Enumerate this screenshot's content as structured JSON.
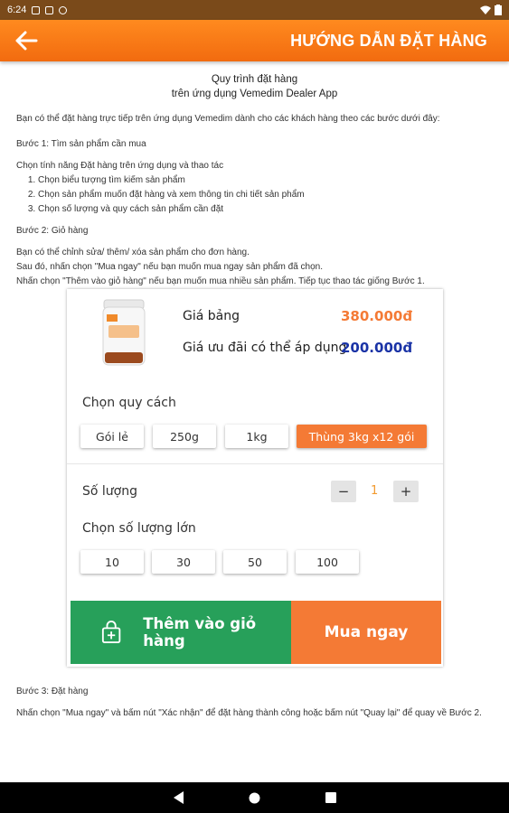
{
  "status_bar": {
    "time": "6:24"
  },
  "app_bar": {
    "title": "HƯỚNG DẪN ĐẶT HÀNG"
  },
  "guide": {
    "title_line1": "Quy trình đặt hàng",
    "title_line2": "trên ứng dụng Vemedim Dealer App",
    "intro": "Bạn có thể đặt hàng trực tiếp trên ứng dụng Vemedim dành cho các khách hàng theo các bước dưới đây:",
    "step1": {
      "heading": "Bước 1: Tìm sản phẩm cần mua",
      "text": "Chọn tính năng Đặt hàng trên ứng dụng và thao tác",
      "items": [
        "Chọn biểu tượng tìm kiếm sản phẩm",
        "Chọn sản phẩm muốn đặt hàng và xem thông tin chi tiết sản phẩm",
        "Chọn số lượng và quy cách sản phẩm cần đặt"
      ]
    },
    "step2": {
      "heading": "Bước 2: Giỏ hàng",
      "lines": [
        "Bạn có thể chỉnh sửa/ thêm/ xóa sản phẩm cho đơn hàng.",
        "Sau đó, nhấn chọn \"Mua ngay\" nếu bạn muốn mua ngay sản phẩm đã chọn.",
        "Nhấn chọn \"Thêm vào giỏ hàng\" nếu bạn muốn mua nhiều sản phẩm. Tiếp tục thao tác giống Bước 1."
      ]
    },
    "step3": {
      "heading": "Bước 3: Đặt hàng",
      "text": "Nhấn chọn \"Mua ngay\" và bấm nút \"Xác nhận\" để đặt hàng thành công hoặc bấm nút \"Quay lại\" để quay về Bước 2."
    }
  },
  "product_card": {
    "list_price_label": "Giá bảng",
    "list_price": "380.000đ",
    "deal_price_label": "Giá ưu đãi có thể áp dụng",
    "deal_price": "200.000đ",
    "spec_label": "Chọn quy cách",
    "specs": [
      "Gói lẻ",
      "250g",
      "1kg",
      "Thùng 3kg x12 gói"
    ],
    "selected_spec": "Thùng 3kg x12 gói",
    "quantity_label": "Số lượng",
    "quantity": "1",
    "minus": "−",
    "plus": "+",
    "bulk_label": "Chọn số lượng lớn",
    "bulk_options": [
      "10",
      "30",
      "50",
      "100"
    ],
    "add_to_cart": "Thêm vào giỏ hàng",
    "buy_now": "Mua ngay"
  },
  "colors": {
    "accent": "#f47a35",
    "list_price": "#f47a35",
    "deal_price": "#1a33a6",
    "add_to_cart_bg": "#27a05a",
    "app_bar": "#f57c1f"
  },
  "icons": [
    "back-arrow-icon",
    "cart-plus-icon",
    "nav-back-icon",
    "nav-home-icon",
    "nav-recents-icon"
  ]
}
